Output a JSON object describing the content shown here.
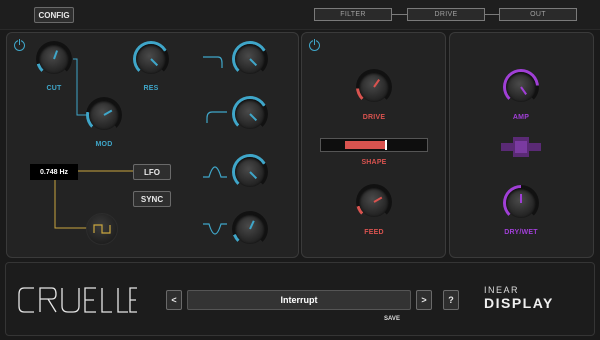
{
  "top": {
    "config_label": "CONFIG",
    "routing": [
      "FILTER",
      "DRIVE",
      "OUT"
    ]
  },
  "filter": {
    "cut_label": "CUT",
    "res_label": "RES",
    "mod_label": "MOD",
    "lfo_rate": "0.748 Hz",
    "lfo_label": "LFO",
    "sync_label": "SYNC"
  },
  "drive": {
    "drive_label": "DRIVE",
    "shape_label": "SHAPE",
    "feed_label": "FEED",
    "shape_value": 0.6
  },
  "output": {
    "amp_label": "AMP",
    "drywet_label": "DRY/WET"
  },
  "footer": {
    "brand_logo": "CRUELLE",
    "prev_label": "<",
    "next_label": ">",
    "help_label": "?",
    "preset_name": "Interrupt",
    "save_label": "SAVE",
    "maker_line1": "INEAR",
    "maker_line2": "DISPLAY"
  },
  "colors": {
    "filter_accent": "#3fa6c9",
    "drive_accent": "#d9534f",
    "output_accent": "#a03fd6",
    "lfo_line": "#c9a63f"
  }
}
